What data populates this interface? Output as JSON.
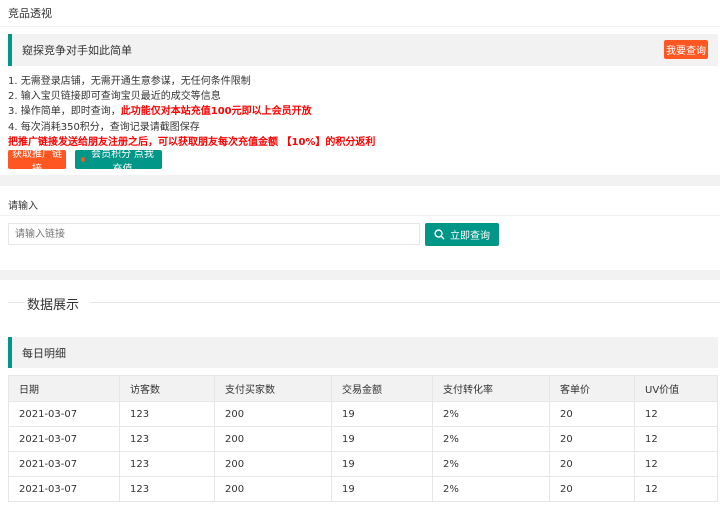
{
  "page_title": "竞品透视",
  "notice": {
    "text": "窥探竞争对手如此简单",
    "button": "我要查询"
  },
  "features": [
    "1. 无需登录店铺，无需开通生意参谋，无任何条件限制",
    "2. 输入宝贝链接即可查询宝贝最近的成交等信息",
    "3. 操作简单，即时查询，",
    "4. 每次消耗350积分，查询记录请截图保存"
  ],
  "feature3_highlight": "此功能仅对本站充值100元即以上会员开放",
  "promo_text": "把推广链接发送给朋友注册之后，可以获取朋友每次充值金额 【10%】的积分返利",
  "buttons": {
    "get_link": "获取推广链接",
    "recharge": "会员积分 点我充值",
    "query": "立即查询"
  },
  "search": {
    "label": "请输入",
    "placeholder": "请输入链接"
  },
  "data_section": {
    "title": "数据展示",
    "subtitle": "每日明细"
  },
  "table": {
    "headers": [
      "日期",
      "访客数",
      "支付买家数",
      "交易金额",
      "支付转化率",
      "客单价",
      "UV价值"
    ],
    "rows": [
      [
        "2021-03-07",
        "123",
        "200",
        "19",
        "2%",
        "20",
        "12"
      ],
      [
        "2021-03-07",
        "123",
        "200",
        "19",
        "2%",
        "20",
        "12"
      ],
      [
        "2021-03-07",
        "123",
        "200",
        "19",
        "2%",
        "20",
        "12"
      ],
      [
        "2021-03-07",
        "123",
        "200",
        "19",
        "2%",
        "20",
        "12"
      ]
    ]
  },
  "colors": {
    "primary": "#009688",
    "orange": "#ff5722",
    "red": "#ff0000"
  }
}
